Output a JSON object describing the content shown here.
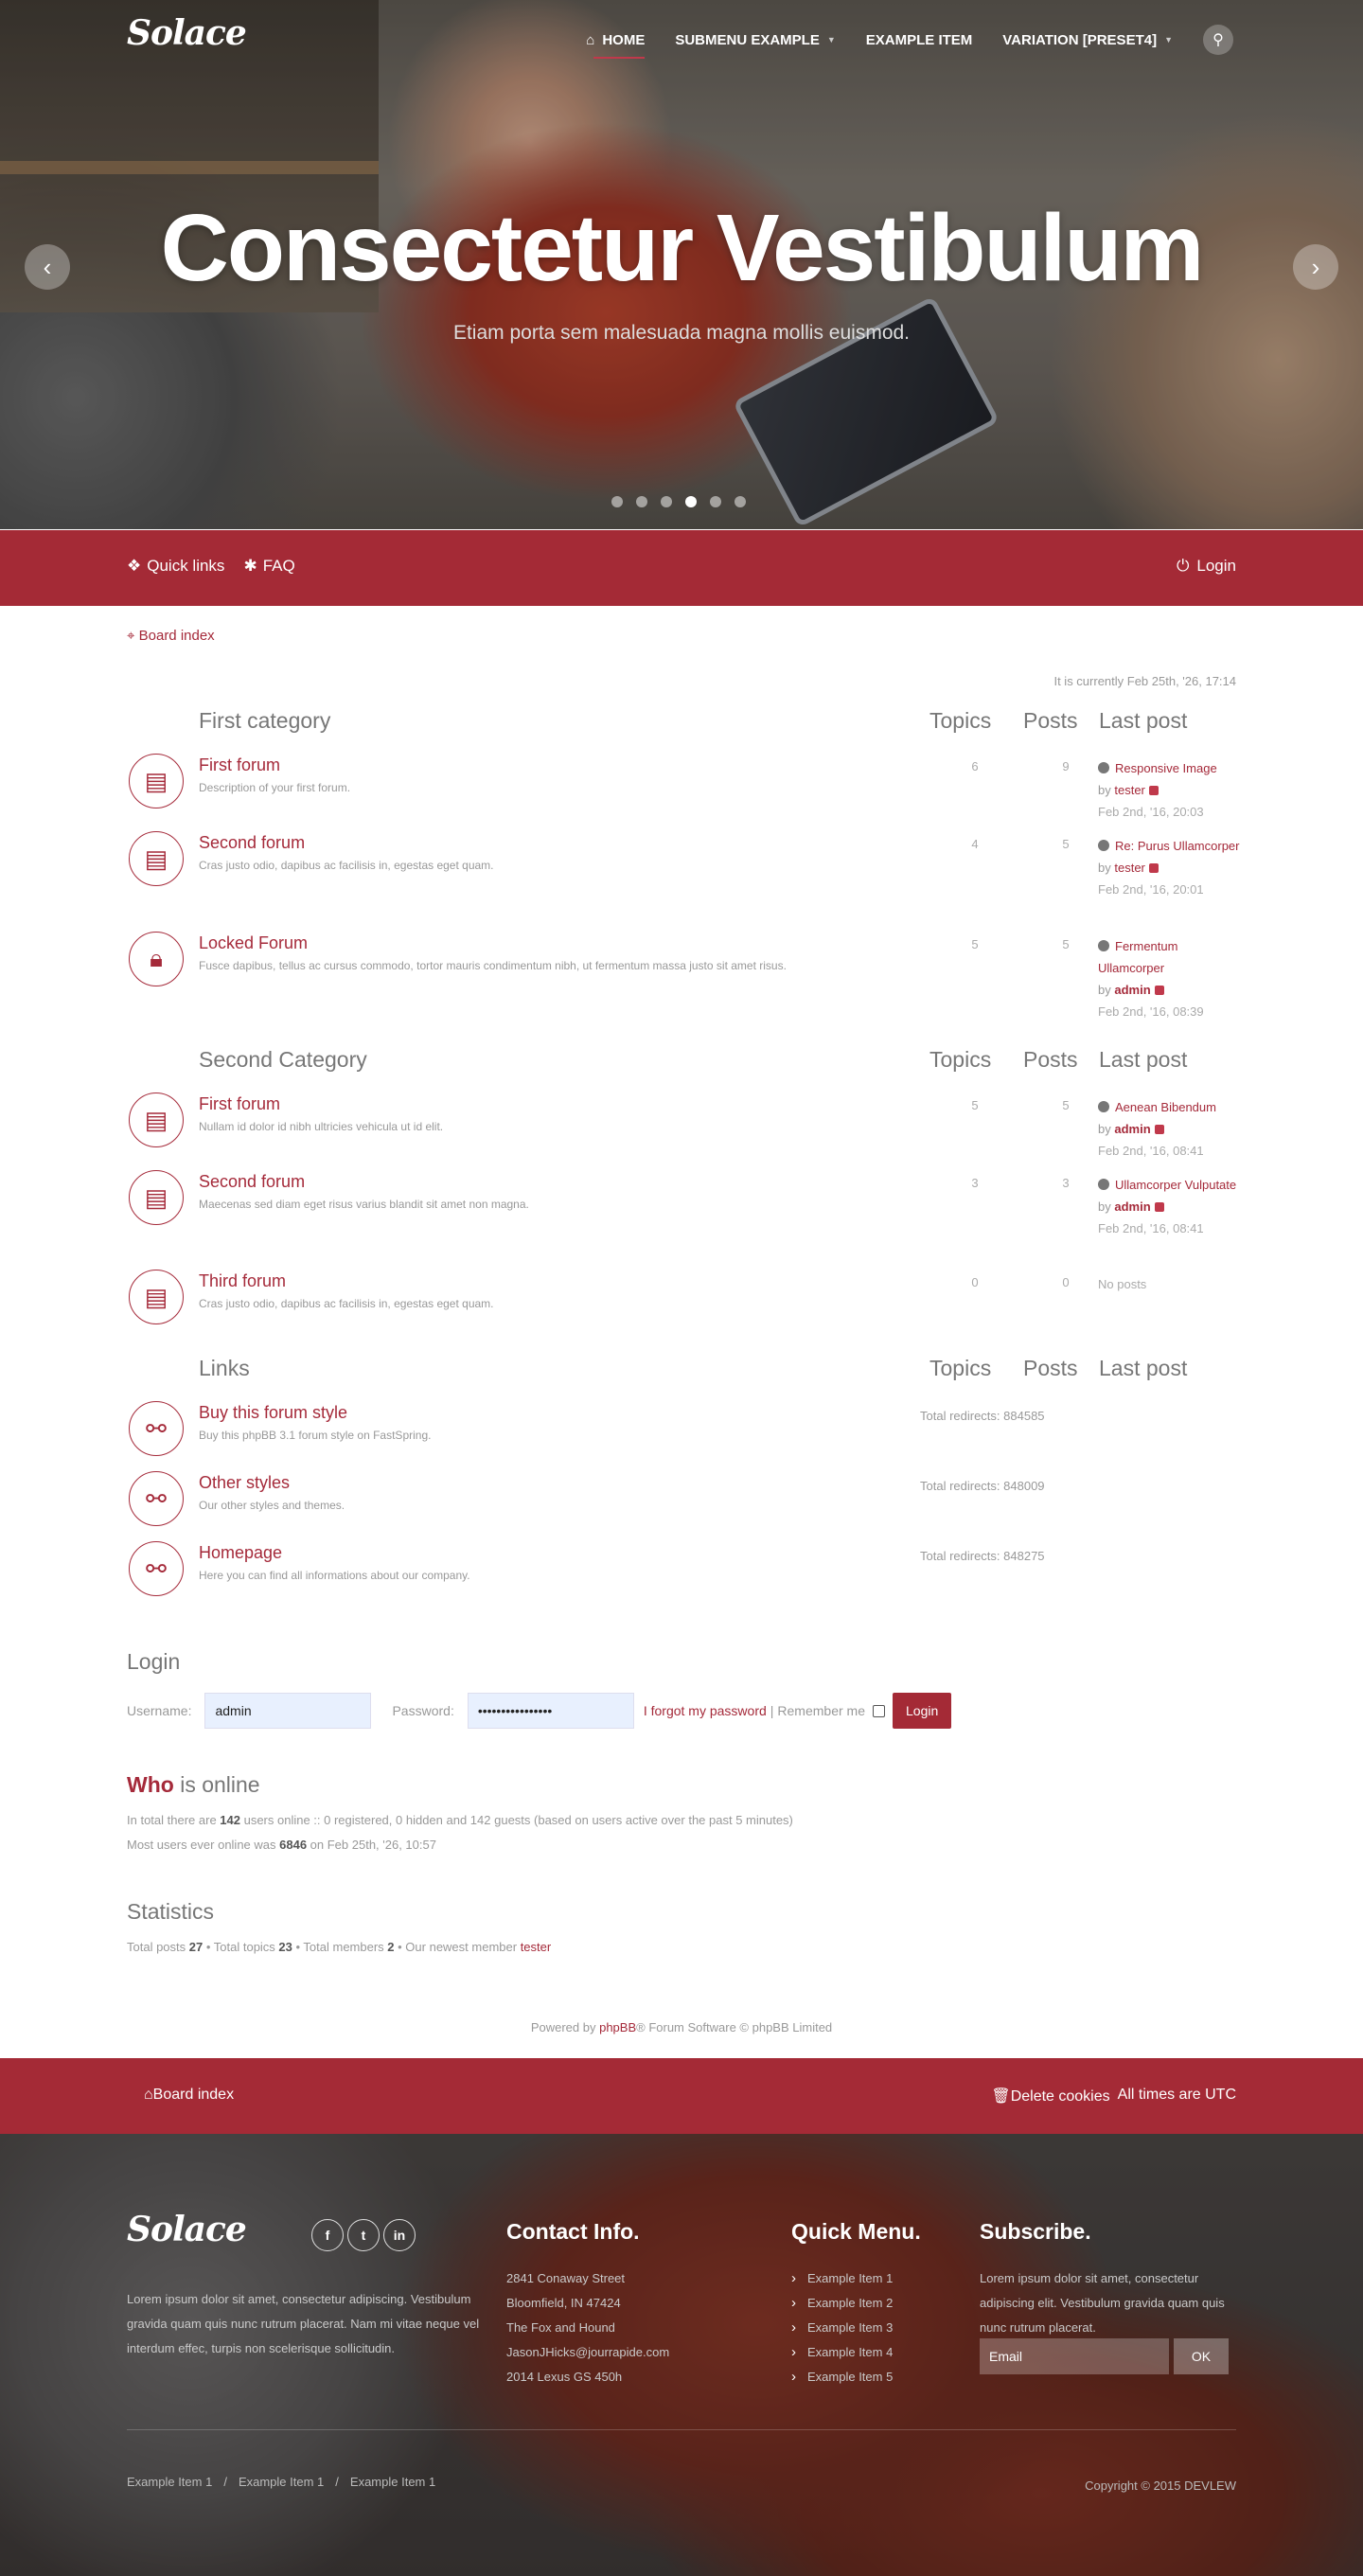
{
  "brand": {
    "logo": "Solace",
    "accent": "#a42a36"
  },
  "nav": {
    "home": "HOME",
    "submenu": "SUBMENU EXAMPLE",
    "example": "EXAMPLE ITEM",
    "variation": "VARIATION [PRESET4]"
  },
  "hero": {
    "title": "Consectetur Vestibulum",
    "subtitle": "Etiam porta sem malesuada magna mollis euismod.",
    "prev": "‹",
    "next": "›",
    "active_slide": 4,
    "slides": 6
  },
  "topbar": {
    "quick_links": "Quick links",
    "faq": "FAQ",
    "login": "Login"
  },
  "breadcrumb": "Board index",
  "current_time": "It is currently Feb 25th, '26, 17:14",
  "columns": {
    "topics": "Topics",
    "posts": "Posts",
    "last_post": "Last post"
  },
  "categories": [
    {
      "title": "First category",
      "forums": [
        {
          "name": "First forum",
          "desc": "Description of your first forum.",
          "topics": "6",
          "posts": "9",
          "last_title": "Responsive Image",
          "by": "by",
          "author": "tester",
          "date": "Feb 2nd, '16, 20:03"
        },
        {
          "name": "Second forum",
          "desc": "Cras justo odio, dapibus ac facilisis in, egestas eget quam.",
          "topics": "4",
          "posts": "5",
          "last_title": "Re: Purus Ullamcorper",
          "by": "by",
          "author": "tester",
          "date": "Feb 2nd, '16, 20:01"
        },
        {
          "name": "Locked Forum",
          "desc": "Fusce dapibus, tellus ac cursus commodo, tortor mauris condimentum nibh, ut fermentum massa justo sit amet risus.",
          "topics": "5",
          "posts": "5",
          "last_title": "Fermentum Ullamcorper",
          "by": "by",
          "author": "admin",
          "date": "Feb 2nd, '16, 08:39"
        }
      ]
    },
    {
      "title": "Second Category",
      "forums": [
        {
          "name": "First forum",
          "desc": "Nullam id dolor id nibh ultricies vehicula ut id elit.",
          "topics": "5",
          "posts": "5",
          "last_title": "Aenean Bibendum",
          "by": "by",
          "author": "admin",
          "date": "Feb 2nd, '16, 08:41"
        },
        {
          "name": "Second forum",
          "desc": "Maecenas sed diam eget risus varius blandit sit amet non magna.",
          "topics": "3",
          "posts": "3",
          "last_title": "Ullamcorper Vulputate",
          "by": "by",
          "author": "admin",
          "date": "Feb 2nd, '16, 08:41"
        },
        {
          "name": "Third forum",
          "desc": "Cras justo odio, dapibus ac facilisis in, egestas eget quam.",
          "topics": "0",
          "posts": "0",
          "no_posts": "No posts"
        }
      ]
    },
    {
      "title": "Links",
      "links": [
        {
          "name": "Buy this forum style",
          "desc": "Buy this phpBB 3.1 forum style on FastSpring.",
          "redirects": "Total redirects: 884585"
        },
        {
          "name": "Other styles",
          "desc": "Our other styles and themes.",
          "redirects": "Total redirects: 848009"
        },
        {
          "name": "Homepage",
          "desc": "Here you can find all informations about our company.",
          "redirects": "Total redirects: 848275"
        }
      ]
    }
  ],
  "login": {
    "title": "Login",
    "username_label": "Username:",
    "username": "admin",
    "password_label": "Password:",
    "password": "••••••••••••••••",
    "forgot": "I forgot my password",
    "sep": "|",
    "remember": "Remember me",
    "button": "Login"
  },
  "online": {
    "title_strong": "Who",
    "title_rest": " is online",
    "line1_a": "In total there are ",
    "count": "142",
    "line1_b": " users online :: 0 registered, 0 hidden and 142 guests (based on users active over the past 5 minutes)",
    "line2_a": "Most users ever online was ",
    "max": "6846",
    "line2_b": " on Feb 25th, '26, 10:57"
  },
  "stats": {
    "title": "Statistics",
    "a": "Total posts ",
    "posts": "27",
    "b": " • Total topics ",
    "topics": "23",
    "c": " • Total members ",
    "members": "2",
    "d": " • Our newest member ",
    "newest": "tester"
  },
  "powered": {
    "a": "Powered by ",
    "link": "phpBB",
    "b": "® Forum Software © phpBB Limited"
  },
  "bottombar": {
    "board_index": "Board index",
    "delete_cookies": "Delete cookies",
    "times": "All times are UTC"
  },
  "footer": {
    "about": "Lorem ipsum dolor sit amet, consectetur adipiscing. Vestibulum gravida quam quis nunc rutrum placerat. Nam mi vitae neque vel interdum effec, turpis non scelerisque sollicitudin.",
    "social": [
      "f",
      "t",
      "in"
    ],
    "contact_title": "Contact Info.",
    "contact": [
      "2841 Conaway Street",
      "Bloomfield, IN 47424",
      "The Fox and Hound",
      "JasonJHicks@jourrapide.com",
      "2014 Lexus GS 450h"
    ],
    "menu_title": "Quick Menu.",
    "menu": [
      "Example Item 1",
      "Example Item 2",
      "Example Item 3",
      "Example Item 4",
      "Example Item 5"
    ],
    "subscribe_title": "Subscribe.",
    "subscribe_text": "Lorem ipsum dolor sit amet, consectetur adipiscing elit. Vestibulum gravida quam quis nunc rutrum placerat.",
    "email_placeholder": "Email",
    "ok": "OK",
    "bottom_links": [
      "Example Item 1",
      "/",
      "Example Item 1",
      "/",
      "Example Item 1"
    ],
    "copyright": "Copyright © 2015 DEVLEW"
  }
}
